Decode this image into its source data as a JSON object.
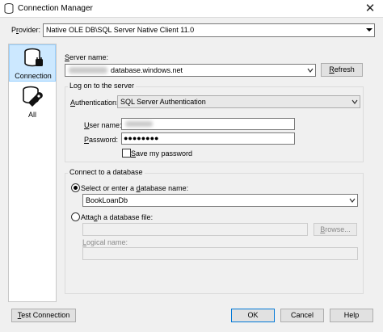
{
  "window": {
    "title": "Connection Manager",
    "close_glyph": "✕"
  },
  "provider": {
    "label": "Provider:",
    "value": "Native OLE DB\\SQL Server Native Client 11.0"
  },
  "nav": {
    "items": [
      {
        "label": "Connection",
        "icon": "database-plug-icon"
      },
      {
        "label": "All",
        "icon": "tools-icon"
      }
    ]
  },
  "server": {
    "label": "Server name:",
    "value": "database.windows.net",
    "refresh": "Refresh"
  },
  "logon": {
    "title": "Log on to the server",
    "auth_label": "Authentication:",
    "auth_value": "SQL Server Authentication",
    "user_label": "User name:",
    "password_label": "Password:",
    "password_value": "●●●●●●●●",
    "save_password": "Save my password"
  },
  "database": {
    "title": "Connect to a database",
    "select_option": "Select or enter a database name:",
    "db_value": "BookLoanDb",
    "attach_option": "Attach a database file:",
    "browse": "Browse...",
    "logical_label": "Logical name:"
  },
  "footer": {
    "test": "Test Connection",
    "ok": "OK",
    "cancel": "Cancel",
    "help": "Help"
  },
  "colors": {
    "selection": "#cce8ff",
    "accent": "#0078d7"
  }
}
